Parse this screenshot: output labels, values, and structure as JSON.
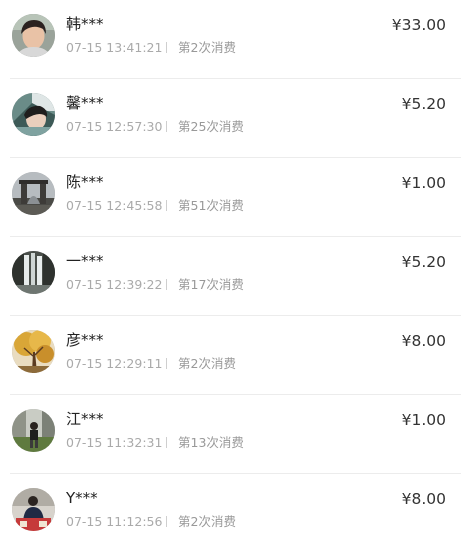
{
  "records": [
    {
      "name": "韩***",
      "time": "07-15 13:41:21",
      "count": "第2次消费",
      "amount": "¥33.00",
      "avatar_icon": "avatar-woman-portrait"
    },
    {
      "name": "馨***",
      "time": "07-15 12:57:30",
      "count": "第25次消费",
      "amount": "¥5.20",
      "avatar_icon": "avatar-woman-selfie"
    },
    {
      "name": "陈***",
      "time": "07-15 12:45:58",
      "count": "第51次消费",
      "amount": "¥1.00",
      "avatar_icon": "avatar-stone-arch"
    },
    {
      "name": "一***",
      "time": "07-15 12:39:22",
      "count": "第17次消费",
      "amount": "¥5.20",
      "avatar_icon": "avatar-waterfall"
    },
    {
      "name": "彦***",
      "time": "07-15 12:29:11",
      "count": "第2次消费",
      "amount": "¥8.00",
      "avatar_icon": "avatar-autumn-tree"
    },
    {
      "name": "江***",
      "time": "07-15 11:32:31",
      "count": "第13次消费",
      "amount": "¥1.00",
      "avatar_icon": "avatar-person-street"
    },
    {
      "name": "Y***",
      "time": "07-15 11:12:56",
      "count": "第2次消费",
      "amount": "¥8.00",
      "avatar_icon": "avatar-person-seated"
    }
  ]
}
